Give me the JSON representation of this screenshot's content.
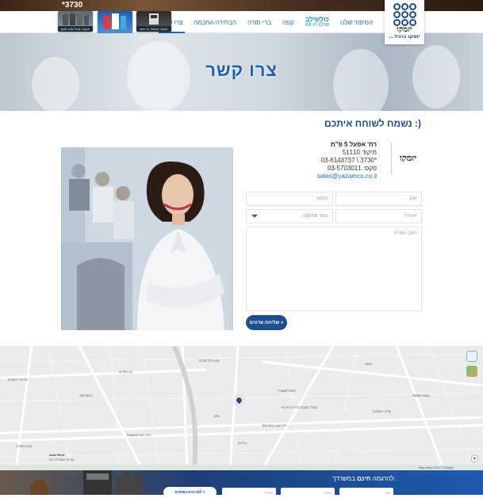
{
  "topbar": {
    "phone": "*3730"
  },
  "logo": {
    "text": "יזמקו",
    "tagline": "...יזמקו כרגיל"
  },
  "nav": {
    "items": [
      {
        "label": "הסיפור שלנו",
        "active": false
      },
      {
        "label": "All in One",
        "sub": "כולשילב",
        "active": false
      },
      {
        "label": "קפה",
        "active": false
      },
      {
        "label": "ברי סודה",
        "active": false
      },
      {
        "label": "הבחירה החכמה",
        "active": false
      },
      {
        "label": "צרו קשר",
        "active": true
      }
    ],
    "promos": [
      {
        "caption": "יזמקו: מיכל מים מסנן"
      },
      {
        "caption": "יזמקו: מערכות לשנייה"
      },
      {
        "caption": "יזמקו: מכשיר גז חכם"
      }
    ]
  },
  "hero": {
    "title": "צרו קשר"
  },
  "greeting": "נשמח לשוחח איתכם :)",
  "contact": {
    "address": "רח' אפעל 5 פ\"ת",
    "zip": "מיקוד 51110",
    "phone": "03-6143737 \\ 3730*",
    "fax": "פקס: 03-5703011",
    "email": "sales@yazamco.co.il",
    "card_logo": "יזמקו"
  },
  "form": {
    "name_placeholder": "שם",
    "phone_placeholder": "טלפון",
    "email_placeholder": "אימייל",
    "department_placeholder": "בחר מחלקה",
    "message_placeholder": "תוכן הפנייה",
    "send_label": "שליחת פרטים »"
  },
  "map": {
    "labels": [
      "אבא הלל סילבר",
      "ז'בוטינסקי",
      "דרך זאב ז'בוטינסקי",
      "מגדל המבנה קריית בית גת",
      "הנשר",
      "בני אפרים",
      "דרך אם המושבות",
      "שדרות ירושלים",
      "גבעת שמואל",
      "פינת המשביר",
      "בית וגן",
      "Aviel Rent",
      "אביאל השכרת רכב",
      "אלון",
      "מרכז העסקים",
      "מרכז ספורט"
    ],
    "attribution": "Map data ©2017 Google",
    "zoom_plus": "+",
    "zoom_minus": "−"
  },
  "footer": {
    "prefix": "להדגמה",
    "bold": "חינם",
    "suffix": "במשרדך:",
    "name_placeholder": "שם",
    "phone_placeholder": "טלפון",
    "email_placeholder": "אימייל",
    "button": "לפרטים נוספים »"
  }
}
